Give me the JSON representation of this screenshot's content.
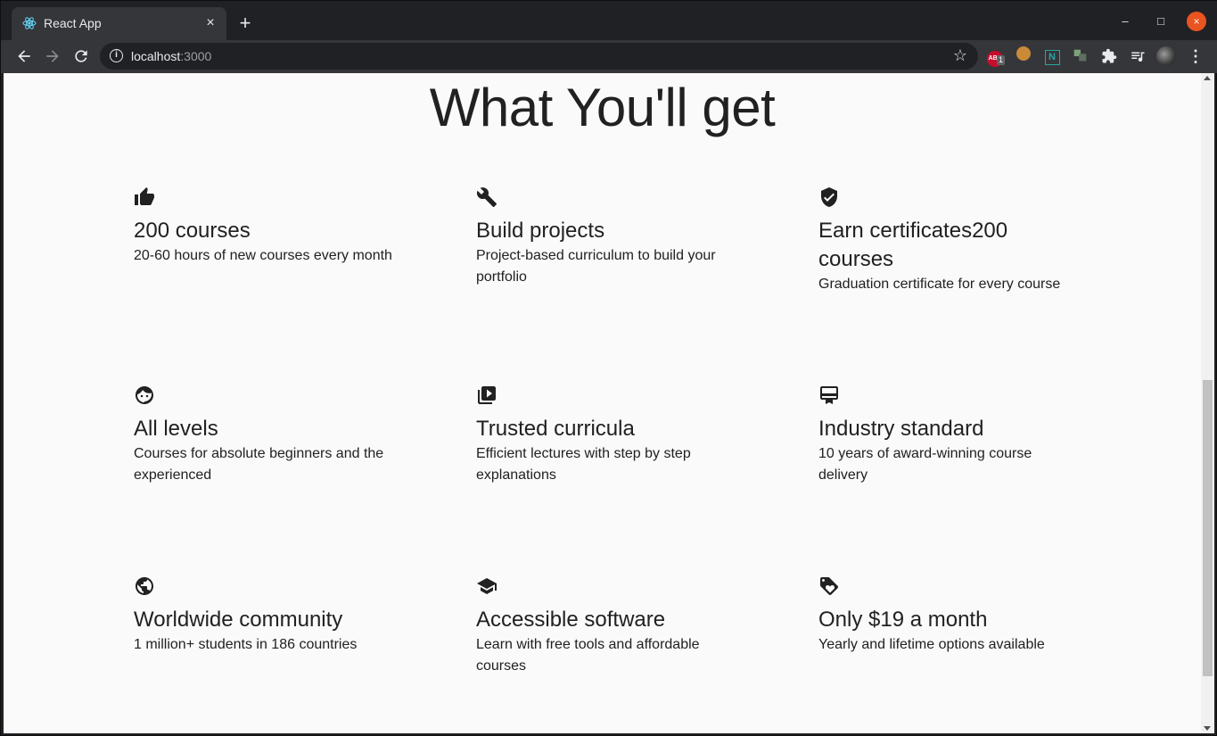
{
  "browser": {
    "tab_title": "React App",
    "tab_close": "×",
    "new_tab": "+",
    "url_host": "localhost",
    "url_port": ":3000",
    "abp_label": "ABP",
    "abp_count": "1",
    "ext_n_label": "N",
    "window_min": "–",
    "window_max": "□",
    "window_close": "×",
    "accent_close": "#e95420"
  },
  "page": {
    "title": "What You'll get",
    "features": [
      {
        "icon": "thumbs-up-icon",
        "title": "200 courses",
        "desc": "20-60 hours of new courses every month"
      },
      {
        "icon": "wrench-icon",
        "title": "Build projects",
        "desc": "Project-based curriculum to build your portfolio"
      },
      {
        "icon": "verified-shield-icon",
        "title": "Earn certificates200 courses",
        "desc": "Graduation certificate for every course"
      },
      {
        "icon": "child-face-icon",
        "title": "All levels",
        "desc": "Courses for absolute beginners and the experienced"
      },
      {
        "icon": "video-library-icon",
        "title": "Trusted curricula",
        "desc": "Efficient lectures with step by step explanations"
      },
      {
        "icon": "card-membership-icon",
        "title": "Industry standard",
        "desc": "10 years of award-winning course delivery"
      },
      {
        "icon": "globe-icon",
        "title": "Worldwide community",
        "desc": "1 million+ students in 186 countries"
      },
      {
        "icon": "school-icon",
        "title": "Accessible software",
        "desc": "Learn with free tools and affordable courses"
      },
      {
        "icon": "price-tag-icon",
        "title": "Only $19 a month",
        "desc": "Yearly and lifetime options available"
      }
    ]
  }
}
